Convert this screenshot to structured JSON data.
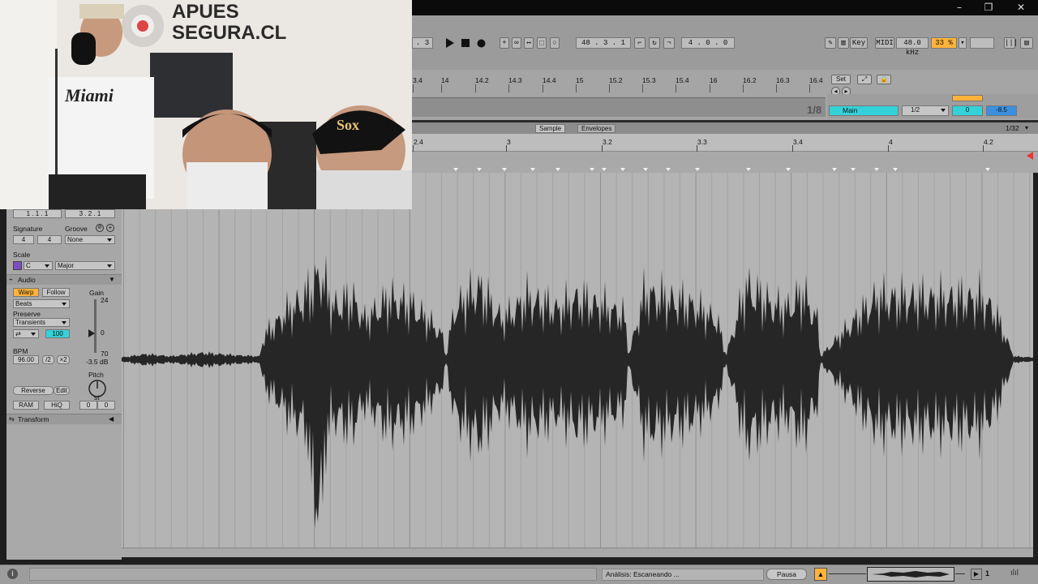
{
  "transport": {
    "position_left": ". 3",
    "arrangement_position": "48 . 3 . 1",
    "loop_length": "4 . 0 . 0",
    "key_label": "Key",
    "midi_label": "MIDI",
    "sample_rate": "48.0 kHz",
    "cpu_load": "33 %"
  },
  "arrangement": {
    "ruler_labels": [
      "3.4",
      "14",
      "14.2",
      "14.3",
      "14.4",
      "15",
      "15.2",
      "15.3",
      "15.4",
      "16",
      "16.2",
      "16.3",
      "16.4"
    ],
    "set_label": "Set",
    "quantize": "1/8",
    "main_track": "Main",
    "launch_quant": "1/2",
    "volume": "0",
    "pan_value": "-8.5"
  },
  "clip_view": {
    "tab_sample": "Sample",
    "tab_envelopes": "Envelopes",
    "grid": "1/32",
    "ruler_labels": [
      "2.4",
      "3",
      "3.2",
      "3.3",
      "3.4",
      "4",
      "4.2"
    ]
  },
  "left_panel": {
    "start": "1 . 1 . 1",
    "end": "3 . 2 . 1",
    "signature_label": "Signature",
    "groove_label": "Groove",
    "sig_num": "4",
    "sig_den": "4",
    "groove_value": "None",
    "scale_label": "Scale",
    "scale_root": "C",
    "scale_mode": "Major",
    "audio_section": "Audio",
    "warp_btn": "Warp",
    "follow_btn": "Follow",
    "gain_label": "Gain",
    "warp_mode": "Beats",
    "preserve_label": "Preserve",
    "preserve_value": "Transients",
    "transient_value": "100",
    "gain_24": "24",
    "gain_0": "0",
    "gain_70": "70",
    "gain_db": "-3.5 dB",
    "bpm_label": "BPM",
    "bpm_value": "96.00",
    "half_btn": "/2",
    "double_btn": "×2",
    "pitch_label": "Pitch",
    "pitch_unit": "st",
    "reverse_btn": "Reverse",
    "edit_btn": "Edit",
    "ram_btn": "RAM",
    "hiq_btn": "HiQ",
    "detune_a": "0",
    "detune_b": "0",
    "transform_section": "Transform"
  },
  "status": {
    "analysis_text": "Análisis: Escaneando ...",
    "pause_btn": "Pausa",
    "page_number": "1"
  },
  "webcam": {
    "wall_sign_line1": "APUES",
    "wall_sign_line2": "SEGURA.CL",
    "jersey_text": "Miami",
    "cap_text": "Sox"
  },
  "colors": {
    "accent_orange": "#ffb33a",
    "accent_cyan": "#35d1d8",
    "waveform": "#262626",
    "clip_bg": "#b4b4b4"
  }
}
